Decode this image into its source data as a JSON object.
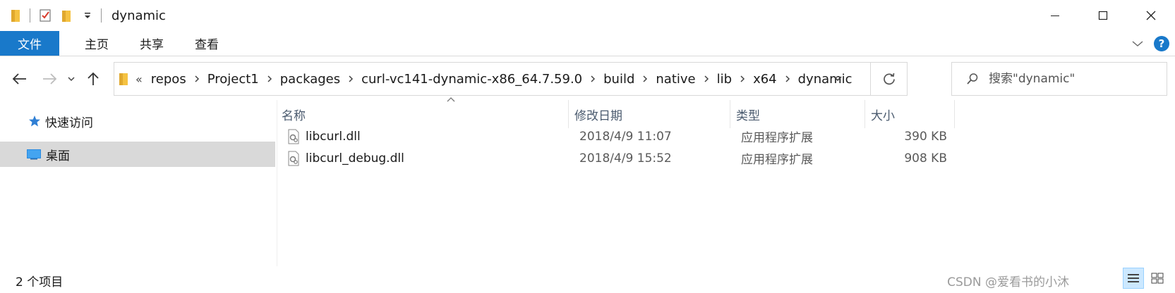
{
  "window": {
    "title": "dynamic",
    "quick_access_icons": [
      "folder-icon",
      "properties-check-icon",
      "new-folder-icon",
      "customize-dropdown-icon"
    ]
  },
  "ribbon": {
    "tabs": [
      "文件",
      "主页",
      "共享",
      "查看"
    ]
  },
  "address_bar": {
    "overflow": "«",
    "breadcrumbs": [
      "repos",
      "Project1",
      "packages",
      "curl-vc141-dynamic-x86_64.7.59.0",
      "build",
      "native",
      "lib",
      "x64",
      "dynamic"
    ]
  },
  "search": {
    "placeholder": "搜索\"dynamic\""
  },
  "sidebar": {
    "items": [
      "快速访问",
      "桌面"
    ]
  },
  "columns": [
    "名称",
    "修改日期",
    "类型",
    "大小"
  ],
  "files": [
    {
      "name": "libcurl.dll",
      "date": "2018/4/9 11:07",
      "type": "应用程序扩展",
      "size": "390 KB"
    },
    {
      "name": "libcurl_debug.dll",
      "date": "2018/4/9 15:52",
      "type": "应用程序扩展",
      "size": "908 KB"
    }
  ],
  "status": {
    "count": "2 个项目",
    "watermark": "CSDN @爱看书的小沐"
  },
  "colors": {
    "accent": "#1979ca",
    "selected": "#d9d9d9",
    "folder": "#f5c242"
  }
}
